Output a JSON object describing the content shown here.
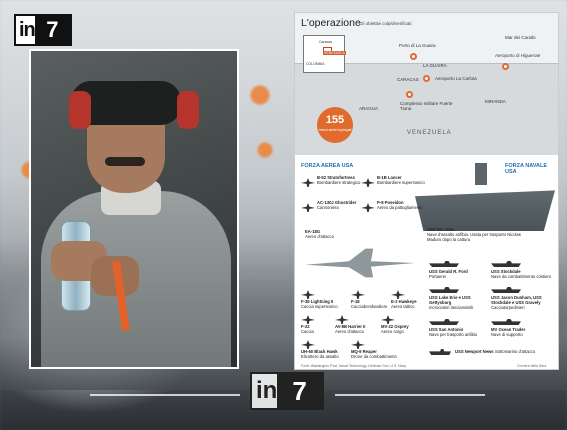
{
  "brand": {
    "logo_in": "in",
    "logo_seven": "7"
  },
  "map": {
    "title": "L'operazione",
    "subtitle": "Gli obiettivi colpiti/verificati",
    "inset": {
      "label_country_main": "VENEZUELA",
      "label_colombia": "COLOMBIA",
      "label_caracas": "Caracas"
    },
    "places": [
      {
        "label": "Mar dei Caraibi"
      },
      {
        "label": "Porto di La Guaira"
      },
      {
        "label": "LA GUAIRA"
      },
      {
        "label": "Aeroporto di Higuerote"
      },
      {
        "label": "CARACAS"
      },
      {
        "label": "Aeroporto La Carlota"
      },
      {
        "label": "ARAGUA"
      },
      {
        "label": "Complesso militare Fuerte Tiuna"
      },
      {
        "label": "MIRANDA"
      }
    ],
    "strikes_count": "155",
    "strikes_label": "mezzi aerei impiegati",
    "country": "VENEZUELA"
  },
  "sections": {
    "air": "FORZA AEREA USA",
    "navy": "FORZA NAVALE USA"
  },
  "air_items": [
    {
      "name": "B-52 Stratofortress",
      "desc": "Bombardiere strategico"
    },
    {
      "name": "B-1B Lancer",
      "desc": "Bombardiere supersonico"
    },
    {
      "name": "AC-130J Ghostrider",
      "desc": "Cannoniera"
    },
    {
      "name": "P-8 Poseidon",
      "desc": "Aereo da pattugliamento"
    },
    {
      "name": "EA-18G",
      "desc": "Aereo d'attacco"
    },
    {
      "name": "F-35 Lightning II",
      "desc": "Caccia supersonico"
    },
    {
      "name": "F-18",
      "desc": "Cacciabombardiere"
    },
    {
      "name": "E-2 Hawkeye",
      "desc": "Aereo tattico"
    },
    {
      "name": "F-22",
      "desc": "Caccia"
    },
    {
      "name": "AV-8B Harrier II",
      "desc": "Aereo d'attacco"
    },
    {
      "name": "MV-22 Osprey",
      "desc": "Aereo cargo"
    },
    {
      "name": "UH-60 Black Hawk",
      "desc": "Elicottero da assalto"
    },
    {
      "name": "MQ-9 Reaper",
      "desc": "Drone da combattimento"
    }
  ],
  "ship_items": [
    {
      "name": "USS Iwo Jima",
      "desc": "Nave d'assalto anfibia. Usata per trasporto Nicolas Maduro dopo la cattura"
    },
    {
      "name": "USS Gerald R. Ford",
      "desc": "Portaerei"
    },
    {
      "name": "USS Stockdale",
      "desc": "Nave da combattimento costiero"
    },
    {
      "name": "USS Lake Erie e USS Gettysburg",
      "desc": "Incrociatori lanciamissili"
    },
    {
      "name": "USS Jason Dunham, USS Stockdale e USS Gravely",
      "desc": "Cacciatorpedinieri"
    },
    {
      "name": "USS San Antonio",
      "desc": "Nave per trasporto anfibio"
    },
    {
      "name": "MV Ocean Trader",
      "desc": "Nave di supporto"
    },
    {
      "name": "USS Newport News",
      "desc": "Sottomarino d'attacco"
    }
  ],
  "footer": {
    "source": "Fonti: Washington Post, Naval Technology, Defense Gov, U.S. Navy",
    "credit": "Corriere della Sera"
  }
}
